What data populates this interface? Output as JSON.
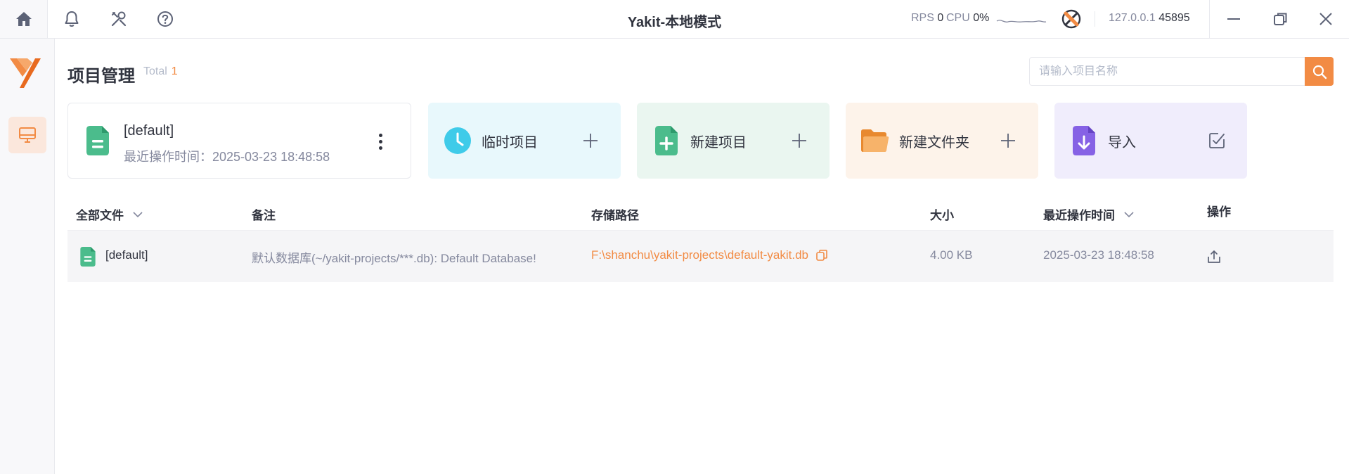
{
  "app": {
    "title": "Yakit-本地模式"
  },
  "status": {
    "rps_label": "RPS",
    "rps_value": "0",
    "cpu_label": "CPU",
    "cpu_value": "0%",
    "host": "127.0.0.1",
    "port": "45895"
  },
  "page": {
    "title": "项目管理",
    "total_label": "Total",
    "total_value": "1"
  },
  "search": {
    "placeholder": "请输入项目名称",
    "value": ""
  },
  "current_project": {
    "name": "[default]",
    "last_time_label": "最近操作时间：",
    "last_time": "2025-03-23 18:48:58"
  },
  "actions": [
    {
      "label": "临时项目",
      "icon": "clock-icon",
      "color": "#3fcbe9"
    },
    {
      "label": "新建项目",
      "icon": "file-plus-icon",
      "color": "#4bbc8c"
    },
    {
      "label": "新建文件夹",
      "icon": "folder-icon",
      "color": "#f5a04f"
    },
    {
      "label": "导入",
      "icon": "file-download-icon",
      "color": "#8662e5"
    }
  ],
  "table": {
    "columns": [
      "全部文件",
      "备注",
      "存储路径",
      "大小",
      "最近操作时间",
      "操作"
    ],
    "rows": [
      {
        "name": "[default]",
        "note": "默认数据库(~/yakit-projects/***.db): Default Database!",
        "path": "F:\\shanchu\\yakit-projects\\default-yakit.db",
        "size": "4.00 KB",
        "time": "2025-03-23 18:48:58"
      }
    ]
  },
  "colors": {
    "accent": "#f28b44",
    "text": "#31343f",
    "muted": "#85899e"
  }
}
